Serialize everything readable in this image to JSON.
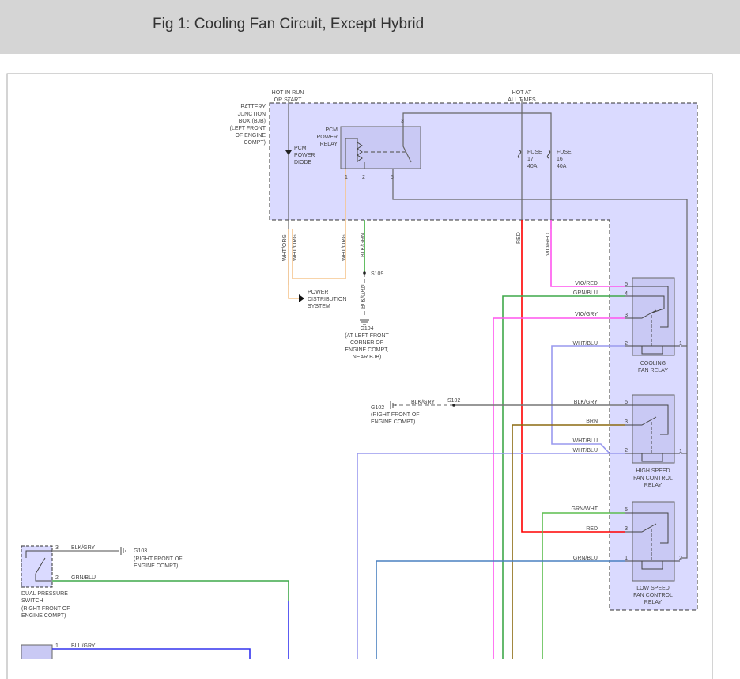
{
  "header": {
    "title": "Fig 1: Cooling Fan Circuit, Except Hybrid"
  },
  "colors": {
    "bjb_fill": "#dadaff",
    "relay_fill": "#c9c9f4",
    "wht_org": "#f5c58e",
    "blk_grn": "#3cae3c",
    "red": "#ff0000",
    "vio": "#ff55ee",
    "grn_blu": "#3fa84a",
    "wht_blu": "#9999ee",
    "brn": "#8b6a10",
    "grn_wht": "#5cbd4e",
    "blu_gry": "#3333ee",
    "gray": "#777777"
  },
  "labels": {
    "hot_run": [
      "HOT IN RUN",
      "OR START"
    ],
    "bjb": [
      "BATTERY",
      "JUNCTION",
      "BOX (BJB)",
      "(LEFT FRONT",
      "OF ENGINE",
      "COMPT)"
    ],
    "diode": [
      "PCM",
      "POWER",
      "DIODE"
    ],
    "pcm_relay": [
      "PCM",
      "POWER",
      "RELAY"
    ],
    "hot_all": [
      "HOT AT",
      "ALL TIMES"
    ],
    "fuse17": [
      "FUSE",
      "17",
      "40A"
    ],
    "fuse16": [
      "FUSE",
      "16",
      "40A"
    ],
    "power_dist": [
      "POWER",
      "DISTRIBUTION",
      "SYSTEM"
    ],
    "g104": [
      "G104",
      "(AT LEFT FRONT",
      "CORNER OF",
      "ENGINE COMPT,",
      "NEAR BJB)"
    ],
    "g102": [
      "G102",
      "(RIGHT FRONT OF",
      "ENGINE COMPT)"
    ],
    "g103": [
      "G103",
      "(RIGHT FRONT OF",
      "ENGINE COMPT)"
    ],
    "dual_switch": [
      "DUAL PRESSURE",
      "SWITCH",
      "(RIGHT FRONT OF",
      "ENGINE COMPT)"
    ],
    "cooling_relay": [
      "COOLING",
      "FAN RELAY"
    ],
    "high_relay": [
      "HIGH SPEED",
      "FAN CONTROL",
      "RELAY"
    ],
    "low_relay": [
      "LOW SPEED",
      "FAN CONTROL",
      "RELAY"
    ],
    "s109": "S109",
    "s102": "S102"
  },
  "wires": {
    "wht_org": "WHT/ORG",
    "blk_grn": "BLK/GRN",
    "red": "RED",
    "vio_red": "VIO/RED",
    "grn_blu": "GRN/BLU",
    "vio_gry": "VIO/GRY",
    "wht_blu": "WHT/BLU",
    "blk_gry": "BLK/GRY",
    "brn": "BRN",
    "grn_wht": "GRN/WHT",
    "blu_gry": "BLU/GRY"
  },
  "pins": {
    "p1": "1",
    "p2": "2",
    "p3": "3",
    "p4": "4",
    "p5": "5"
  }
}
